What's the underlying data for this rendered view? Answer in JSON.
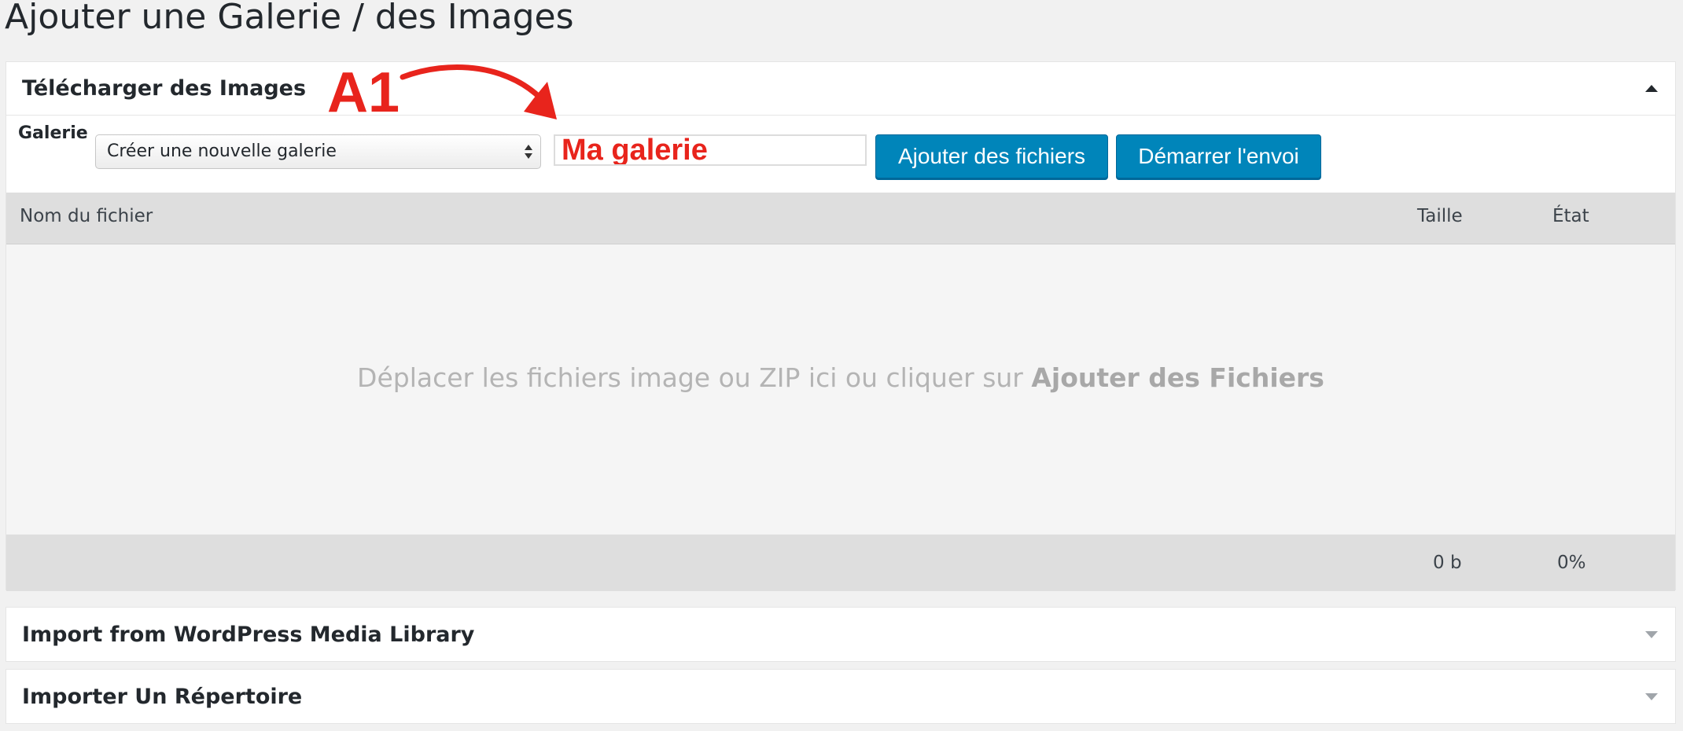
{
  "page": {
    "title": "Ajouter une Galerie / des Images"
  },
  "upload_panel": {
    "title": "Télécharger des Images",
    "gallery_label": "Galerie",
    "gallery_select": {
      "selected": "Créer une nouvelle galerie"
    },
    "gallery_name_input": {
      "value": "Ma galerie"
    },
    "add_files_button": "Ajouter des fichiers",
    "start_upload_button": "Démarrer l'envoi",
    "table": {
      "columns": [
        "Nom du fichier",
        "Taille",
        "État"
      ],
      "dropzone_text": "Déplacer les fichiers image ou ZIP ici ou cliquer sur ",
      "dropzone_bold": "Ajouter des Fichiers",
      "footer": {
        "total_size": "0 b",
        "progress": "0%"
      }
    }
  },
  "other_panels": [
    {
      "title": "Import from WordPress Media Library"
    },
    {
      "title": "Importer Un Répertoire"
    }
  ],
  "annotation": {
    "label": "A1",
    "color": "#e8241c"
  },
  "colors": {
    "button": "#0085ba",
    "accent_red": "#e8241c",
    "background": "#f1f1f1"
  }
}
